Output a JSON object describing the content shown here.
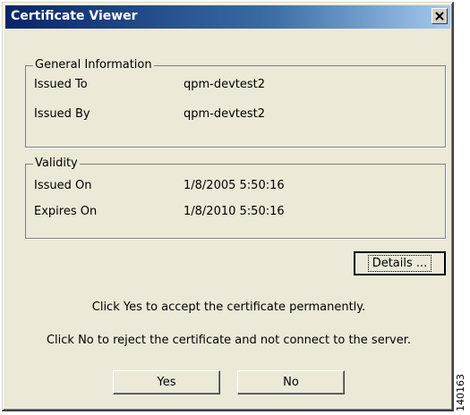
{
  "window": {
    "title": "Certificate Viewer",
    "close_label": "×"
  },
  "general": {
    "legend": "General Information",
    "rows": [
      {
        "label": "Issued To",
        "value": "qpm-devtest2"
      },
      {
        "label": "Issued By",
        "value": "qpm-devtest2"
      }
    ]
  },
  "validity": {
    "legend": "Validity",
    "rows": [
      {
        "label": "Issued On",
        "value": "1/8/2005 5:50:16"
      },
      {
        "label": "Expires On",
        "value": "1/8/2010 5:50:16"
      }
    ]
  },
  "details_label": "Details ...",
  "messages": {
    "accept": "Click Yes to accept the certificate permanently.",
    "reject": "Click No to reject the certificate and not connect to the server."
  },
  "buttons": {
    "yes": "Yes",
    "no": "No"
  },
  "figure_number": "140163",
  "icons": {
    "close": "close-icon"
  },
  "colors": {
    "title_bar_start": "#0a246a",
    "title_bar_end": "#a6caf0",
    "dialog_background": "#ece9d8"
  }
}
